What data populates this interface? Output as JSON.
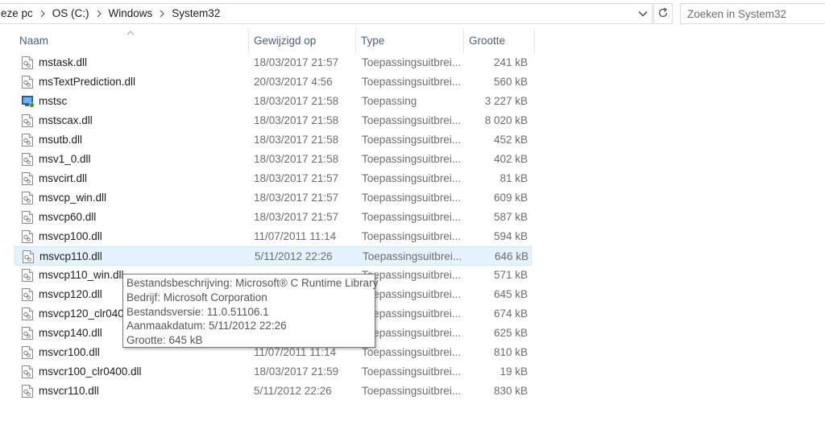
{
  "address": {
    "crumbs": [
      "eze pc",
      "OS (C:)",
      "Windows",
      "System32"
    ],
    "dropdown_icon": "chevron-down-icon",
    "refresh_icon": "refresh-icon"
  },
  "search": {
    "placeholder": "Zoeken in System32"
  },
  "columns": {
    "name": "Naam",
    "date": "Gewijzigd op",
    "type": "Type",
    "size": "Grootte"
  },
  "files": [
    {
      "name": "mstask.dll",
      "date": "18/03/2017 21:57",
      "type": "Toepassingsuitbrei...",
      "size": "241 kB",
      "icon": "dll"
    },
    {
      "name": "msTextPrediction.dll",
      "date": "20/03/2017 4:56",
      "type": "Toepassingsuitbrei...",
      "size": "560 kB",
      "icon": "dll"
    },
    {
      "name": "mstsc",
      "date": "18/03/2017 21:58",
      "type": "Toepassing",
      "size": "3 227 kB",
      "icon": "app"
    },
    {
      "name": "mstscax.dll",
      "date": "18/03/2017 21:58",
      "type": "Toepassingsuitbrei...",
      "size": "8 020 kB",
      "icon": "dll"
    },
    {
      "name": "msutb.dll",
      "date": "18/03/2017 21:58",
      "type": "Toepassingsuitbrei...",
      "size": "452 kB",
      "icon": "dll"
    },
    {
      "name": "msv1_0.dll",
      "date": "18/03/2017 21:58",
      "type": "Toepassingsuitbrei...",
      "size": "402 kB",
      "icon": "dll"
    },
    {
      "name": "msvcirt.dll",
      "date": "18/03/2017 21:57",
      "type": "Toepassingsuitbrei...",
      "size": "81 kB",
      "icon": "dll"
    },
    {
      "name": "msvcp_win.dll",
      "date": "18/03/2017 21:57",
      "type": "Toepassingsuitbrei...",
      "size": "609 kB",
      "icon": "dll"
    },
    {
      "name": "msvcp60.dll",
      "date": "18/03/2017 21:57",
      "type": "Toepassingsuitbrei...",
      "size": "587 kB",
      "icon": "dll"
    },
    {
      "name": "msvcp100.dll",
      "date": "11/07/2011 11:14",
      "type": "Toepassingsuitbrei...",
      "size": "594 kB",
      "icon": "dll"
    },
    {
      "name": "msvcp110.dll",
      "date": "5/11/2012 22:26",
      "type": "Toepassingsuitbrei...",
      "size": "646 kB",
      "icon": "dll",
      "hover": true
    },
    {
      "name": "msvcp110_win.dll",
      "date": "",
      "type": "Toepassingsuitbrei...",
      "size": "571 kB",
      "icon": "dll"
    },
    {
      "name": "msvcp120.dll",
      "date": "",
      "type": "Toepassingsuitbrei...",
      "size": "645 kB",
      "icon": "dll"
    },
    {
      "name": "msvcp120_clr0400",
      "date": "",
      "type": "Toepassingsuitbrei...",
      "size": "674 kB",
      "icon": "dll"
    },
    {
      "name": "msvcp140.dll",
      "date": "",
      "type": "Toepassingsuitbrei...",
      "size": "625 kB",
      "icon": "dll"
    },
    {
      "name": "msvcr100.dll",
      "date": "11/07/2011 11:14",
      "type": "Toepassingsuitbrei...",
      "size": "810 kB",
      "icon": "dll"
    },
    {
      "name": "msvcr100_clr0400.dll",
      "date": "18/03/2017 21:59",
      "type": "Toepassingsuitbrei...",
      "size": "19 kB",
      "icon": "dll"
    },
    {
      "name": "msvcr110.dll",
      "date": "5/11/2012 22:26",
      "type": "Toepassingsuitbrei...",
      "size": "830 kB",
      "icon": "dll"
    }
  ],
  "tooltip": {
    "lines": [
      "Bestandsbeschrijving: Microsoft® C Runtime Library",
      "Bedrijf: Microsoft Corporation",
      "Bestandsversie: 11.0.51106.1",
      "Aanmaakdatum: 5/11/2012 22:26",
      "Grootte: 645 kB"
    ]
  }
}
